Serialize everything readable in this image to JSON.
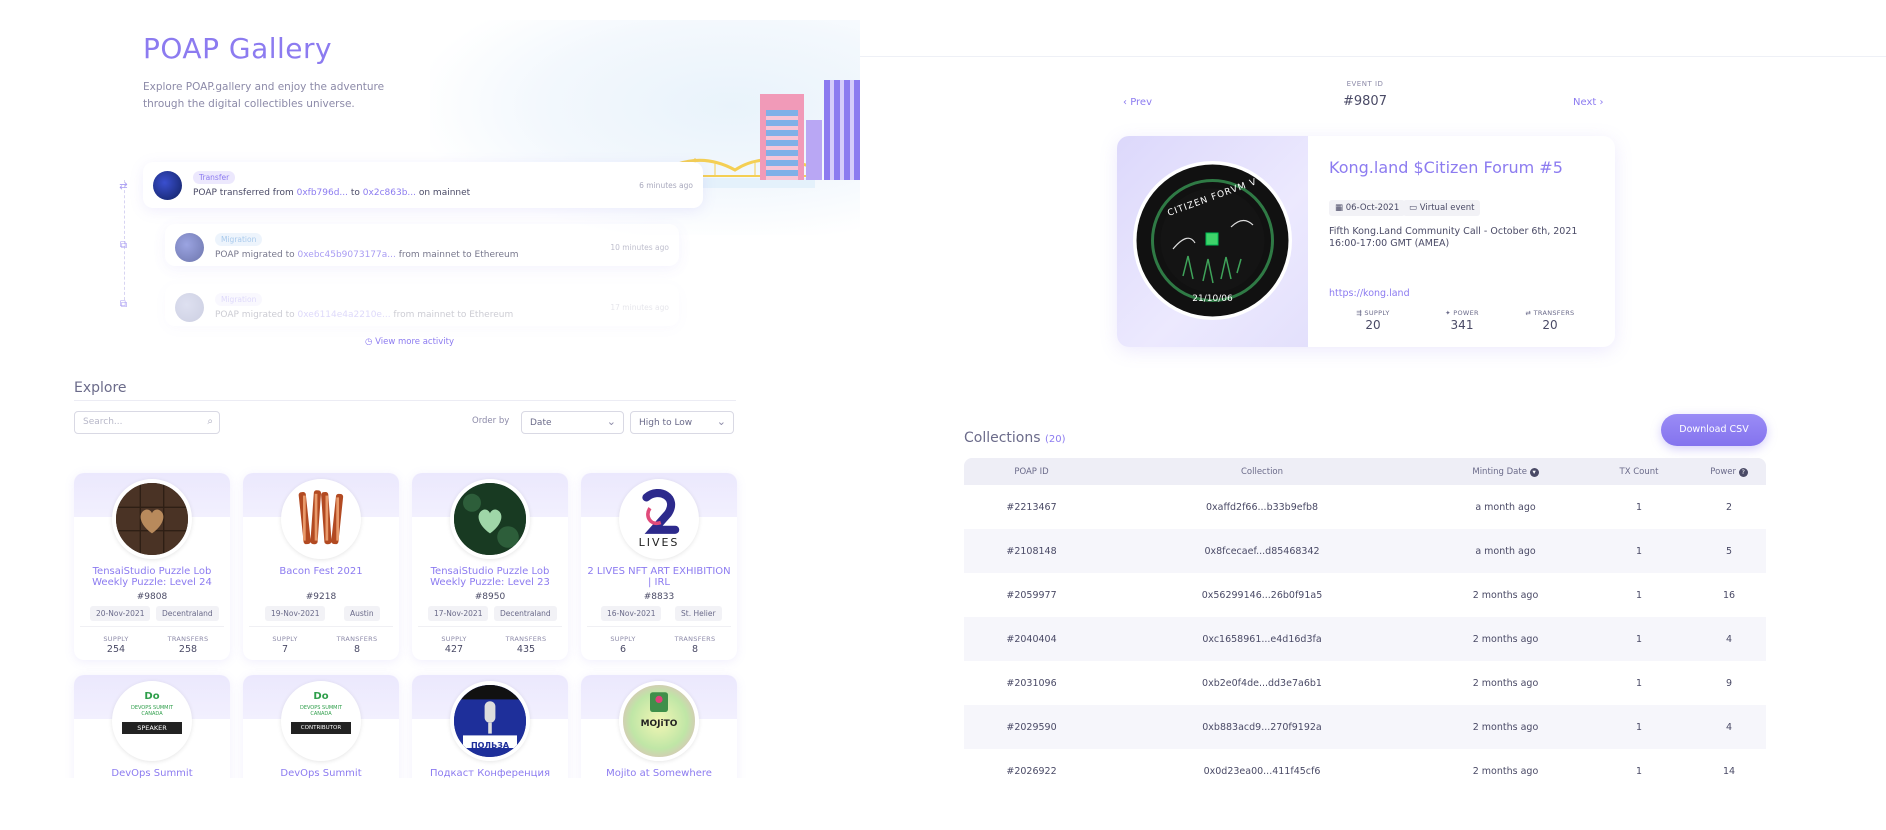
{
  "gallery": {
    "title": "POAP Gallery",
    "subtitle": "Explore POAP.gallery and enjoy the adventure through the digital collectibles universe."
  },
  "activity": [
    {
      "tag": "Transfer",
      "pre": "POAP transferred from ",
      "a": "0xfb796d...",
      "mid": " to ",
      "b": "0x2c863b...",
      "post": " on mainnet",
      "time": "6 minutes ago"
    },
    {
      "tag": "Migration",
      "pre": "POAP migrated to ",
      "a": "0xebc45b9073177a...",
      "mid": " from mainnet to Ethereum",
      "b": "",
      "post": "",
      "time": "10 minutes ago"
    },
    {
      "tag": "Migration",
      "pre": "POAP migrated to ",
      "a": "0xe6114e4a2210e...",
      "mid": " from mainnet to Ethereum",
      "b": "",
      "post": "",
      "time": "17 minutes ago"
    }
  ],
  "view_more": "View more activity",
  "explore": {
    "title": "Explore",
    "search_placeholder": "Search...",
    "order_by_label": "Order by",
    "order_field": "Date",
    "order_direction": "High to Low"
  },
  "cards": [
    {
      "name": "TensaiStudio Puzzle Lob Weekly Puzzle: Level 24",
      "id": "#9808",
      "date": "20-Nov-2021",
      "place": "Decentraland",
      "supply_label": "SUPPLY",
      "supply": "254",
      "transfers_label": "TRANSFERS",
      "transfers": "258"
    },
    {
      "name": "Bacon Fest 2021",
      "id": "#9218",
      "date": "19-Nov-2021",
      "place": "Austin",
      "supply_label": "SUPPLY",
      "supply": "7",
      "transfers_label": "TRANSFERS",
      "transfers": "8"
    },
    {
      "name": "TensaiStudio Puzzle Lob Weekly Puzzle: Level 23",
      "id": "#8950",
      "date": "17-Nov-2021",
      "place": "Decentraland",
      "supply_label": "SUPPLY",
      "supply": "427",
      "transfers_label": "TRANSFERS",
      "transfers": "435"
    },
    {
      "name": "2 LIVES NFT ART EXHIBITION | IRL",
      "id": "#8833",
      "date": "16-Nov-2021",
      "place": "St. Helier",
      "supply_label": "SUPPLY",
      "supply": "6",
      "transfers_label": "TRANSFERS",
      "transfers": "8"
    },
    {
      "name": "DevOps Summit"
    },
    {
      "name": "DevOps Summit"
    },
    {
      "name": "Подкаст Конференция"
    },
    {
      "name": "Mojito at Somewhere"
    }
  ],
  "card_art": {
    "lives_text": "LIVES",
    "devops_speaker": "SPEAKER",
    "devops_contributor": "CONTRIBUTOR",
    "devops_title": "DEVOPS SUMMIT CANADA",
    "mojito_text": "MOJiTO",
    "podcast_text": "ПОЛЬЗА"
  },
  "event": {
    "prev": "Prev",
    "next": "Next",
    "id_label": "EVENT ID",
    "id": "#9807",
    "title": "Kong.land $Citizen Forum #5",
    "date": "06-Oct-2021",
    "type": "Virtual event",
    "description": "Fifth Kong.Land Community Call - October 6th, 2021 16:00-17:00 GMT (AMEA)",
    "link": "https://kong.land",
    "badge_text": "CITIZEN FORVM V",
    "badge_date": "21/10/06",
    "stats": [
      {
        "label": "SUPPLY",
        "value": "20"
      },
      {
        "label": "POWER",
        "value": "341"
      },
      {
        "label": "TRANSFERS",
        "value": "20"
      }
    ]
  },
  "collections": {
    "title": "Collections",
    "count": "(20)",
    "download": "Download CSV",
    "headers": [
      "POAP ID",
      "Collection",
      "Minting Date",
      "TX Count",
      "Power"
    ],
    "rows": [
      [
        "#2213467",
        "0xaffd2f66...b33b9efb8",
        "a month ago",
        "1",
        "2"
      ],
      [
        "#2108148",
        "0x8fcecaef...d85468342",
        "a month ago",
        "1",
        "5"
      ],
      [
        "#2059977",
        "0x56299146...26b0f91a5",
        "2 months ago",
        "1",
        "16"
      ],
      [
        "#2040404",
        "0xc1658961...e4d16d3fa",
        "2 months ago",
        "1",
        "4"
      ],
      [
        "#2031096",
        "0xb2e0f4de...dd3e7a6b1",
        "2 months ago",
        "1",
        "9"
      ],
      [
        "#2029590",
        "0xb883acd9...270f9192a",
        "2 months ago",
        "1",
        "4"
      ],
      [
        "#2026922",
        "0x0d23ea00...411f45cf6",
        "2 months ago",
        "1",
        "14"
      ]
    ]
  },
  "colors": {
    "accent": "#8c7bf0",
    "text": "#4a4a66",
    "muted": "#8c8aa8"
  }
}
